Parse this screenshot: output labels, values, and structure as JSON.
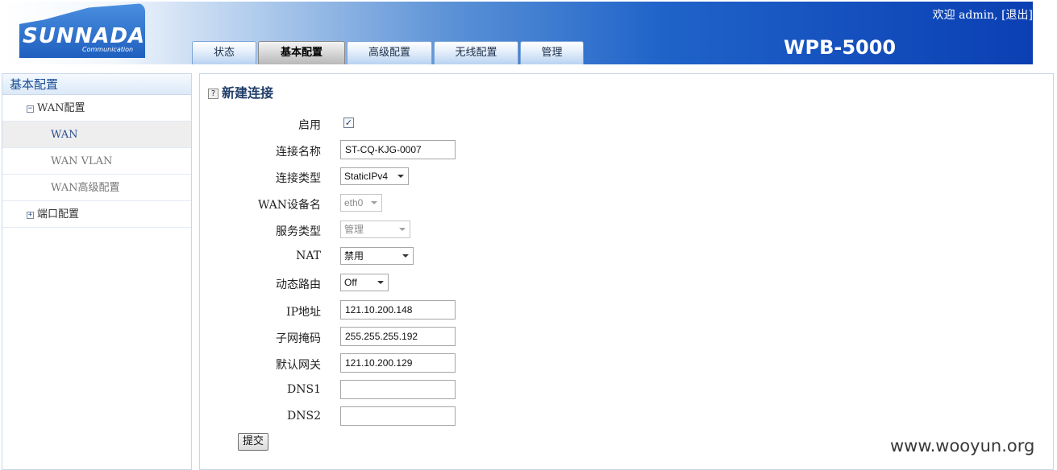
{
  "header": {
    "logo_text": "SUNNADA",
    "logo_sub": "Communication",
    "product_name": "WPB-5000",
    "welcome": "欢迎 admin, [",
    "logout_label": "退出",
    "welcome_end": "]",
    "tabs": [
      {
        "label": "状态"
      },
      {
        "label": "基本配置"
      },
      {
        "label": "高级配置"
      },
      {
        "label": "无线配置"
      },
      {
        "label": "管理"
      }
    ]
  },
  "sidebar": {
    "title": "基本配置",
    "wan_group": {
      "toggle": "−",
      "label": "WAN配置"
    },
    "items": [
      {
        "label": "WAN"
      },
      {
        "label": "WAN VLAN"
      },
      {
        "label": "WAN高级配置"
      }
    ],
    "port_group": {
      "toggle": "+",
      "label": "端口配置"
    }
  },
  "form": {
    "title": "新建连接",
    "help_glyph": "?",
    "enable_label": "启用",
    "enable_checked": "✓",
    "conn_name_label": "连接名称",
    "conn_name_value": "ST-CQ-KJG-0007",
    "conn_type_label": "连接类型",
    "conn_type_value": "StaticIPv4",
    "wan_dev_label": "WAN设备名",
    "wan_dev_value": "eth0",
    "service_type_label": "服务类型",
    "service_type_value": "管理",
    "nat_label": "NAT",
    "nat_value": "禁用",
    "dyn_route_label": "动态路由",
    "dyn_route_value": "Off",
    "ip_label": "IP地址",
    "ip_value": "121.10.200.148",
    "mask_label": "子网掩码",
    "mask_value": "255.255.255.192",
    "gateway_label": "默认网关",
    "gateway_value": "121.10.200.129",
    "dns1_label": "DNS1",
    "dns1_value": "",
    "dns2_label": "DNS2",
    "dns2_value": "",
    "submit_label": "提交"
  },
  "watermark": "www.wooyun.org"
}
